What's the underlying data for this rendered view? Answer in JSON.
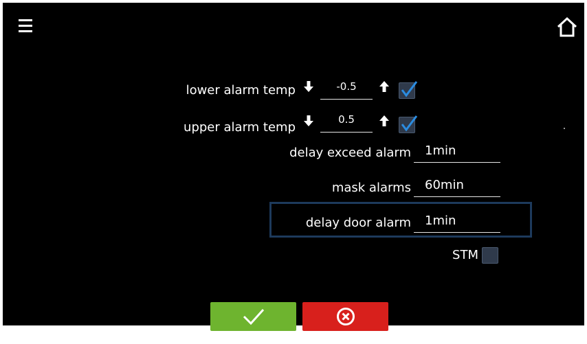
{
  "toolbar": {
    "menu_icon": "hamburger-menu-icon",
    "home_icon": "home-icon"
  },
  "alarms": {
    "lower": {
      "label": "lower alarm temp",
      "value": "-0.5",
      "checked": true
    },
    "upper": {
      "label": "upper alarm temp",
      "value": "0.5",
      "checked": true
    },
    "delay_exceed": {
      "label": "delay exceed alarm",
      "value": "1min"
    },
    "mask": {
      "label": "mask alarms",
      "value": "60min"
    },
    "delay_door": {
      "label": "delay door alarm",
      "value": "1min"
    },
    "stm": {
      "label": "STM",
      "checked": false
    }
  },
  "actions": {
    "confirm_icon": "checkmark-icon",
    "cancel_icon": "cancel-circle-x-icon"
  },
  "colors": {
    "screen_bg": "#000000",
    "text": "#ffffff",
    "checkbox_fill": "#2f3a4b",
    "check_mark": "#2b8ce0",
    "selection_border": "#1d3a5c",
    "confirm_button": "#6eb42f",
    "cancel_button": "#d8201c"
  }
}
